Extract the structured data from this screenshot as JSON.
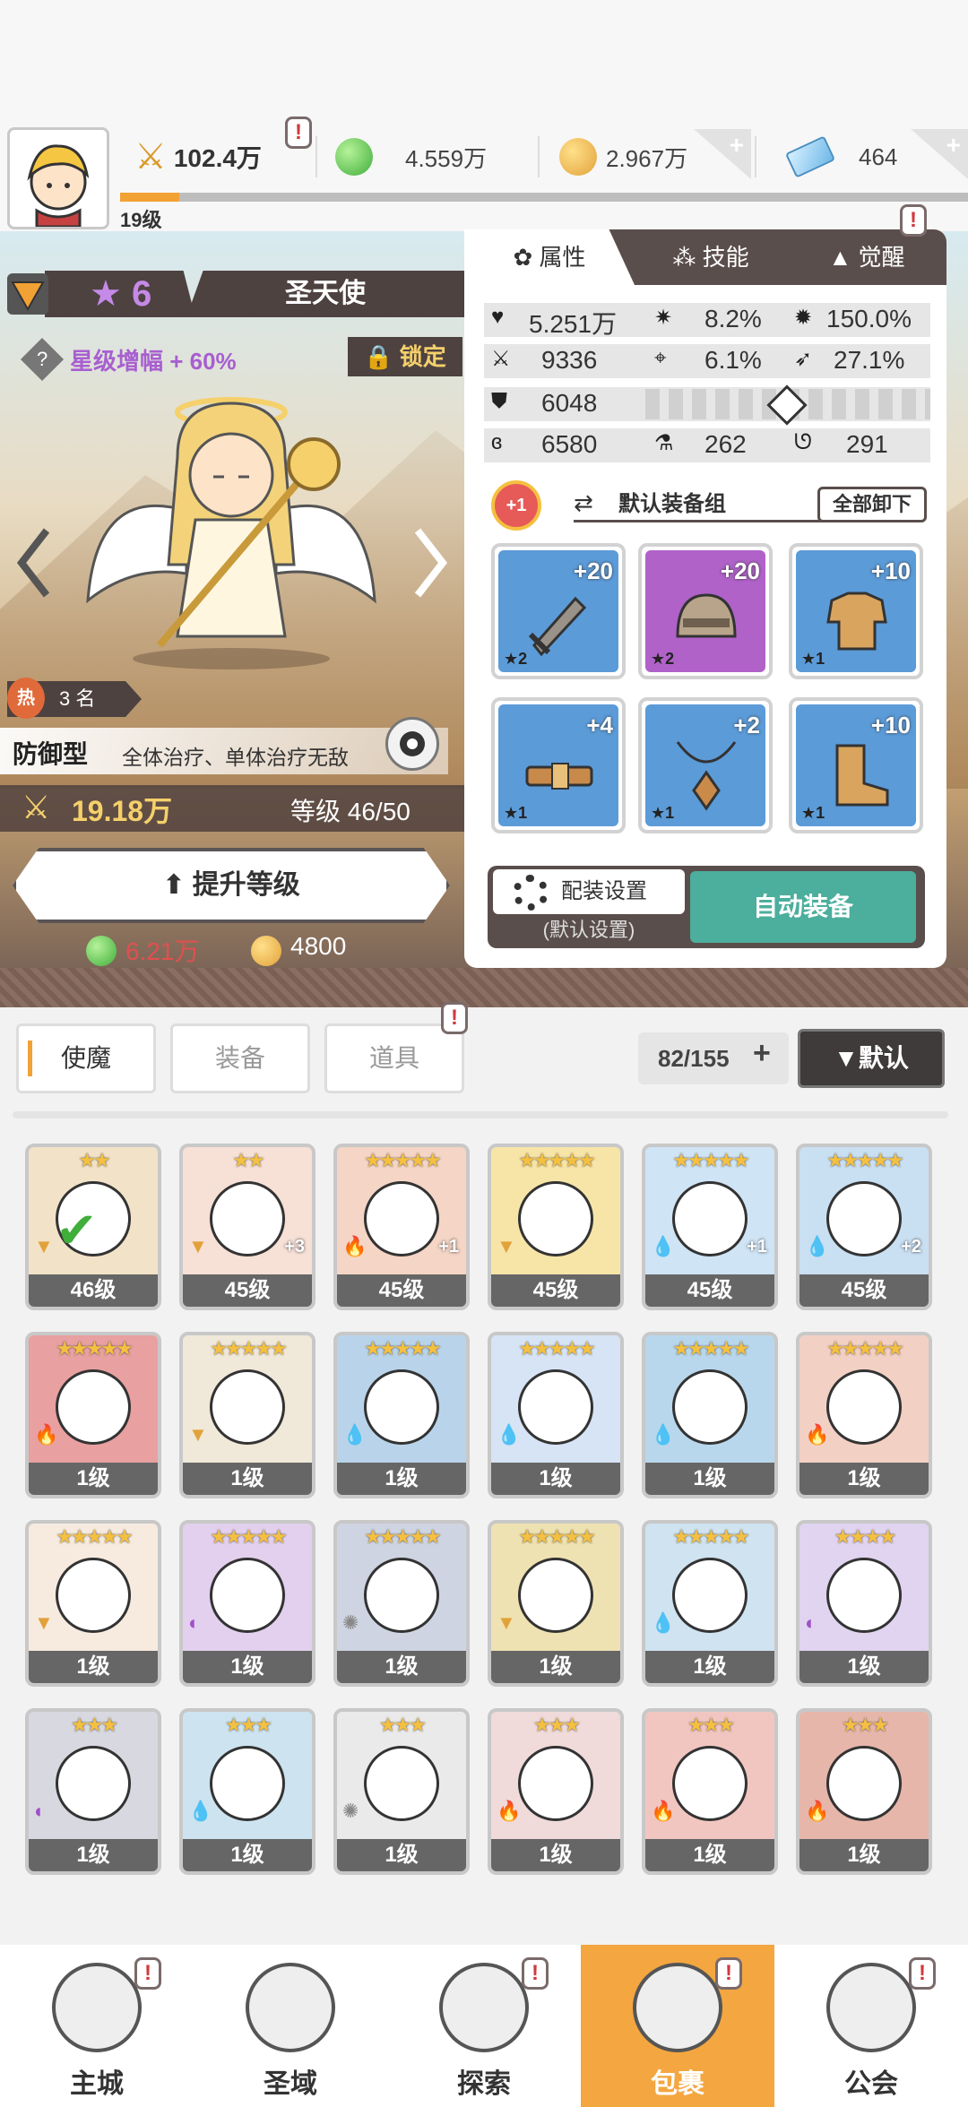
{
  "topbar": {
    "power": "102.4万",
    "green_gem": "4.559万",
    "gold": "2.967万",
    "diamond": "464",
    "player_level": "19级",
    "xp_progress": 0.07
  },
  "hero": {
    "star": "6",
    "name": "圣天使",
    "star_boost": "星级增幅 + 60%",
    "lock_label": "锁定",
    "hot_rank": "3 名",
    "hot_icon": "热",
    "role": "防御型",
    "role_desc": "全体治疗、单体治疗无敌",
    "power": "19.18万",
    "level_label": "等级 46/50",
    "upgrade_label": "提升等级",
    "cost_green": "6.21万",
    "cost_gold": "4800"
  },
  "panel": {
    "tabs": [
      "属性",
      "技能",
      "觉醒"
    ],
    "stats": {
      "hp": "5.251万",
      "crit_rate": "8.2%",
      "crit_dmg": "150.0%",
      "atk": "9336",
      "accuracy": "6.1%",
      "speed": "27.1%",
      "def": "6048",
      "res": "6580",
      "stat_a": "262",
      "stat_b": "291"
    },
    "plus_badge": "+1",
    "equip_group": "默认装备组",
    "unequip_all": "全部卸下",
    "slots": [
      {
        "level": "+20",
        "stars": "★2",
        "color": "#5b9bd8",
        "item": "sword"
      },
      {
        "level": "+20",
        "stars": "★2",
        "color": "#b062c9",
        "item": "helmet"
      },
      {
        "level": "+10",
        "stars": "★1",
        "color": "#5b9bd8",
        "item": "armor"
      },
      {
        "level": "+4",
        "stars": "★1",
        "color": "#5b9bd8",
        "item": "belt"
      },
      {
        "level": "+2",
        "stars": "★1",
        "color": "#5b9bd8",
        "item": "necklace"
      },
      {
        "level": "+10",
        "stars": "★1",
        "color": "#5b9bd8",
        "item": "boots"
      }
    ],
    "cfg_label": "配装设置",
    "cfg_sub": "(默认设置)",
    "auto_equip": "自动装备"
  },
  "list": {
    "tabs": [
      "使魔",
      "装备",
      "道具"
    ],
    "count": "82/155",
    "count_plus": "+",
    "sort": "▼默认",
    "cards": [
      {
        "lvl": "46级",
        "stars": "★★",
        "bg": "#f2e3c8",
        "el": "▼",
        "el_color": "#e2a23a",
        "extra": ""
      },
      {
        "lvl": "45级",
        "stars": "★★",
        "bg": "#f7e0d6",
        "el": "▼",
        "el_color": "#e2a23a",
        "extra": "+3"
      },
      {
        "lvl": "45级",
        "stars": "★★★★★",
        "bg": "#f5d5c5",
        "el": "🔥",
        "el_color": "#e05a3a",
        "extra": "+1"
      },
      {
        "lvl": "45级",
        "stars": "★★★★★",
        "bg": "#f7e5a8",
        "el": "▼",
        "el_color": "#e2a23a",
        "extra": ""
      },
      {
        "lvl": "45级",
        "stars": "★★★★★",
        "bg": "#cfe4f5",
        "el": "💧",
        "el_color": "#3a8ae0",
        "extra": "+1"
      },
      {
        "lvl": "45级",
        "stars": "★★★★★",
        "bg": "#c9dff2",
        "el": "💧",
        "el_color": "#3a8ae0",
        "extra": "+2"
      },
      {
        "lvl": "1级",
        "stars": "★★★★★",
        "bg": "#e8a0a0",
        "el": "🔥",
        "el_color": "#e05a3a",
        "extra": ""
      },
      {
        "lvl": "1级",
        "stars": "★★★★★",
        "bg": "#f0e8d8",
        "el": "▼",
        "el_color": "#e2a23a",
        "extra": ""
      },
      {
        "lvl": "1级",
        "stars": "★★★★★",
        "bg": "#b9d4ea",
        "el": "💧",
        "el_color": "#3a8ae0",
        "extra": ""
      },
      {
        "lvl": "1级",
        "stars": "★★★★★",
        "bg": "#d6e4f5",
        "el": "💧",
        "el_color": "#3a8ae0",
        "extra": ""
      },
      {
        "lvl": "1级",
        "stars": "★★★★★",
        "bg": "#b8d7ec",
        "el": "💧",
        "el_color": "#3a8ae0",
        "extra": ""
      },
      {
        "lvl": "1级",
        "stars": "★★★★★",
        "bg": "#f3d0c4",
        "el": "🔥",
        "el_color": "#e05a3a",
        "extra": ""
      },
      {
        "lvl": "1级",
        "stars": "★★★★★",
        "bg": "#f7eadf",
        "el": "▼",
        "el_color": "#e2a23a",
        "extra": ""
      },
      {
        "lvl": "1级",
        "stars": "★★★★★",
        "bg": "#e2d0ee",
        "el": "◐",
        "el_color": "#a050c8",
        "extra": ""
      },
      {
        "lvl": "1级",
        "stars": "★★★★★",
        "bg": "#cfd4e2",
        "el": "✺",
        "el_color": "#888",
        "extra": ""
      },
      {
        "lvl": "1级",
        "stars": "★★★★★",
        "bg": "#efe2b2",
        "el": "▼",
        "el_color": "#e2a23a",
        "extra": ""
      },
      {
        "lvl": "1级",
        "stars": "★★★★★",
        "bg": "#cfe3f1",
        "el": "💧",
        "el_color": "#3a8ae0",
        "extra": ""
      },
      {
        "lvl": "1级",
        "stars": "★★★★",
        "bg": "#e0d4f0",
        "el": "◐",
        "el_color": "#a050c8",
        "extra": ""
      },
      {
        "lvl": "1级",
        "stars": "★★★",
        "bg": "#d8d8e0",
        "el": "◐",
        "el_color": "#a050c8",
        "extra": ""
      },
      {
        "lvl": "1级",
        "stars": "★★★",
        "bg": "#cde3f0",
        "el": "💧",
        "el_color": "#3a8ae0",
        "extra": ""
      },
      {
        "lvl": "1级",
        "stars": "★★★",
        "bg": "#eaeaea",
        "el": "✺",
        "el_color": "#888",
        "extra": ""
      },
      {
        "lvl": "1级",
        "stars": "★★★",
        "bg": "#f0dada",
        "el": "🔥",
        "el_color": "#e05a3a",
        "extra": ""
      },
      {
        "lvl": "1级",
        "stars": "★★★",
        "bg": "#f2c6c0",
        "el": "🔥",
        "el_color": "#e05a3a",
        "extra": ""
      },
      {
        "lvl": "1级",
        "stars": "★★★",
        "bg": "#e7b6aa",
        "el": "🔥",
        "el_color": "#e05a3a",
        "extra": ""
      }
    ]
  },
  "nav": {
    "items": [
      {
        "label": "主城",
        "alert": true
      },
      {
        "label": "圣域",
        "alert": false
      },
      {
        "label": "探索",
        "alert": true
      },
      {
        "label": "包裹",
        "alert": true
      },
      {
        "label": "公会",
        "alert": true
      }
    ],
    "active_index": 3
  },
  "colors": {
    "accent_orange": "#f4a640",
    "teal_button": "#4cae9c",
    "dark_panel": "#5a4e4c",
    "gold_text": "#f5d06b"
  }
}
